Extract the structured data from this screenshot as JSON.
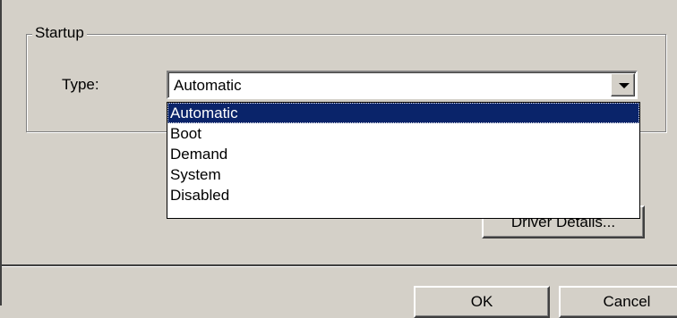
{
  "startup": {
    "group_title": "Startup",
    "type_label": "Type:",
    "selected_value": "Automatic",
    "options": [
      "Automatic",
      "Boot",
      "Demand",
      "System",
      "Disabled"
    ],
    "highlighted_index": 0
  },
  "buttons": {
    "driver_details": "Driver Details...",
    "ok": "OK",
    "cancel": "Cancel"
  },
  "icons": {
    "dropdown_arrow": "chevron-down-icon"
  },
  "colors": {
    "face": "#d4d0c8",
    "highlight": "#0a246a",
    "highlight_text": "#ffffff"
  }
}
